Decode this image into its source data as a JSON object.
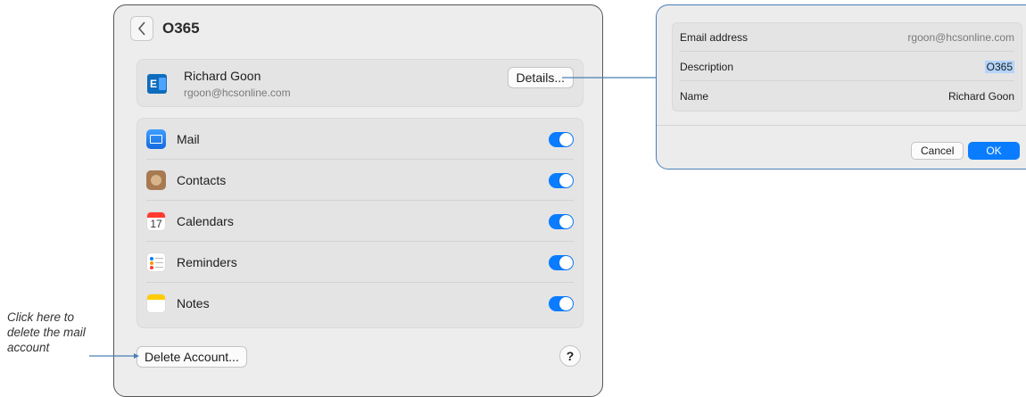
{
  "panel": {
    "title": "O365",
    "account": {
      "name": "Richard Goon",
      "email": "rgoon@hcsonline.com",
      "details_label": "Details..."
    },
    "services": [
      {
        "label": "Mail",
        "icon": "mail-icon",
        "enabled": true
      },
      {
        "label": "Contacts",
        "icon": "contacts-icon",
        "enabled": true
      },
      {
        "label": "Calendars",
        "icon": "calendar-icon",
        "enabled": true,
        "icon_text": "17"
      },
      {
        "label": "Reminders",
        "icon": "reminders-icon",
        "enabled": true
      },
      {
        "label": "Notes",
        "icon": "notes-icon",
        "enabled": true
      }
    ],
    "delete_label": "Delete Account...",
    "help_label": "?"
  },
  "dialog": {
    "fields": [
      {
        "label": "Email address",
        "value": "rgoon@hcsonline.com"
      },
      {
        "label": "Description",
        "value": "O365"
      },
      {
        "label": "Name",
        "value": "Richard Goon"
      }
    ],
    "cancel_label": "Cancel",
    "ok_label": "OK"
  },
  "annotation": {
    "text": "Click here to delete the mail account"
  },
  "colors": {
    "accent": "#0a7cff",
    "callout_line": "#4a7fb5",
    "selection": "#b3d4fc"
  }
}
